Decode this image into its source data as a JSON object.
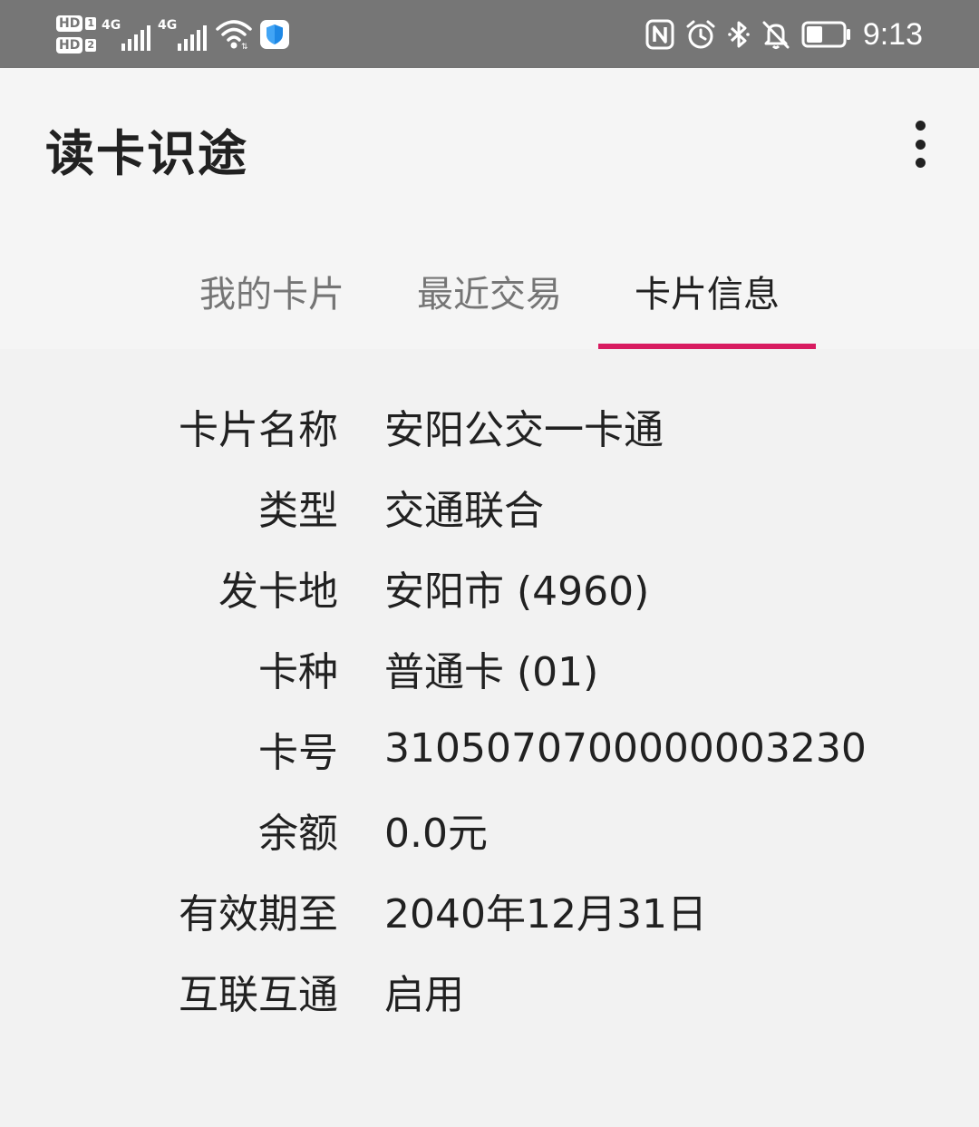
{
  "status_bar": {
    "hd1": "HD",
    "hd1_sim": "1",
    "hd2": "HD",
    "hd2_sim": "2",
    "net1": "4G",
    "net2": "4G",
    "time": "9:13",
    "icons": [
      "signal-icon",
      "wifi-icon",
      "shield-icon",
      "nfc-icon",
      "alarm-icon",
      "bluetooth-icon",
      "notifications-off-icon",
      "battery-icon"
    ]
  },
  "app_bar": {
    "title": "读卡识途",
    "menu_icon": "more-vert-icon"
  },
  "tabs": [
    {
      "label": "我的卡片",
      "active": false
    },
    {
      "label": "最近交易",
      "active": false
    },
    {
      "label": "卡片信息",
      "active": true
    }
  ],
  "colors": {
    "accent": "#d81b60",
    "status_bar": "#767676",
    "background": "#f2f2f2"
  },
  "card_info": [
    {
      "label": "卡片名称",
      "value": "安阳公交一卡通"
    },
    {
      "label": "类型",
      "value": "交通联合"
    },
    {
      "label": "发卡地",
      "value": "安阳市 (4960)"
    },
    {
      "label": "卡种",
      "value": "普通卡 (01)"
    },
    {
      "label": "卡号",
      "value": "3105070700000003230"
    },
    {
      "label": "余额",
      "value": "0.0元"
    },
    {
      "label": "有效期至",
      "value": "2040年12月31日"
    },
    {
      "label": "互联互通",
      "value": "启用"
    }
  ]
}
